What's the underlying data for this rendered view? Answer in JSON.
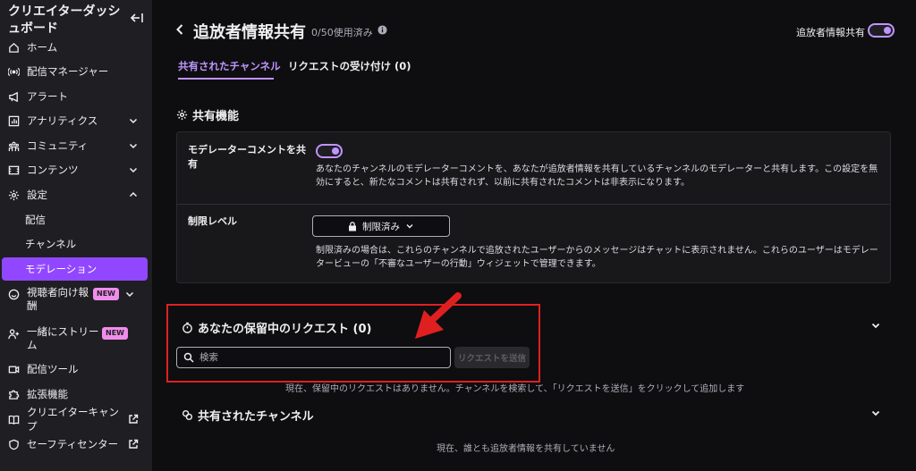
{
  "sidebar": {
    "title": "クリエイターダッシュボード",
    "items": [
      {
        "label": "ホーム"
      },
      {
        "label": "配信マネージャー"
      },
      {
        "label": "アラート"
      },
      {
        "label": "アナリティクス"
      },
      {
        "label": "コミュニティ"
      },
      {
        "label": "コンテンツ"
      },
      {
        "label": "設定"
      },
      {
        "label": "配信"
      },
      {
        "label": "チャンネル"
      },
      {
        "label": "モデレーション"
      },
      {
        "label": "視聴者向け報酬",
        "badge": "NEW"
      },
      {
        "label": "一緒にストリーム",
        "badge": "NEW"
      },
      {
        "label": "配信ツール"
      },
      {
        "label": "拡張機能"
      },
      {
        "label": "クリエイターキャンプ"
      },
      {
        "label": "セーフティセンター"
      }
    ]
  },
  "header": {
    "title": "追放者情報共有",
    "usage": "0/50使用済み",
    "toggle_label": "追放者情報共有",
    "toggle_on": true
  },
  "tabs": [
    {
      "label": "共有されたチャンネル",
      "active": true
    },
    {
      "label": "リクエストの受け付け (0)",
      "active": false
    }
  ],
  "sharing": {
    "heading": "共有機能",
    "mod_comment_label": "モデレーターコメントを共有",
    "mod_comment_on": true,
    "mod_comment_desc": "あなたのチャンネルのモデレーターコメントを、あなたが追放者情報を共有しているチャンネルのモデレーターと共有します。この設定を無効にすると、新たなコメントは共有されず、以前に共有されたコメントは非表示になります。",
    "restriction_label": "制限レベル",
    "restriction_value": "制限済み",
    "restriction_desc": "制限済みの場合は、これらのチャンネルで追放されたユーザーからのメッセージはチャットに表示されません。これらのユーザーはモデレータービューの「不審なユーザーの行動」ウィジェットで管理できます。"
  },
  "pending": {
    "heading": "あなたの保留中のリクエスト (0)",
    "search_placeholder": "検索",
    "send_label": "リクエストを送信",
    "empty_text": "現在、保留中のリクエストはありません。チャンネルを検索して、「リクエストを送信」をクリックして追加します"
  },
  "shared": {
    "heading": "共有されたチャンネル",
    "empty_text": "現在、誰とも追放者情報を共有していません"
  },
  "colors": {
    "accent": "#9147ff",
    "accent_light": "#bf94ff",
    "highlight": "#e02020",
    "badge": "#f08dec"
  }
}
